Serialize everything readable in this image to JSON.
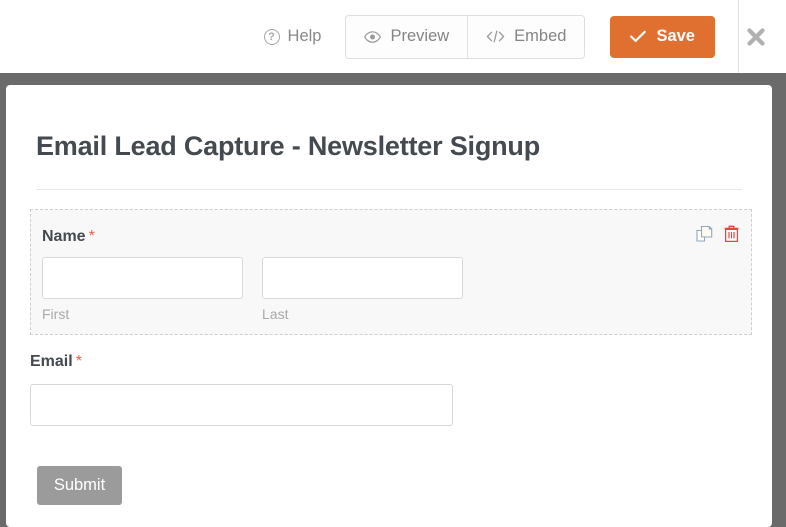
{
  "toolbar": {
    "help_label": "Help",
    "help_icon": "question-circle-icon",
    "preview_label": "Preview",
    "preview_icon": "eye-icon",
    "embed_label": "Embed",
    "embed_icon": "code-icon",
    "save_label": "Save",
    "save_icon": "check-icon",
    "save_color": "#df7030",
    "close_icon": "close-icon"
  },
  "form": {
    "title": "Email Lead Capture - Newsletter Signup",
    "required_marker": "*",
    "fields": [
      {
        "label": "Name",
        "required": true,
        "selected": true,
        "actions": [
          {
            "name": "duplicate-icon",
            "title": "Duplicate"
          },
          {
            "name": "delete-icon",
            "title": "Delete",
            "color": "#e8453c"
          }
        ],
        "inputs": [
          {
            "value": "",
            "placeholder": "",
            "sublabel": "First"
          },
          {
            "value": "",
            "placeholder": "",
            "sublabel": "Last"
          }
        ]
      },
      {
        "label": "Email",
        "required": true,
        "selected": false,
        "inputs": [
          {
            "value": "",
            "placeholder": "",
            "sublabel": ""
          }
        ]
      }
    ],
    "submit_label": "Submit"
  }
}
